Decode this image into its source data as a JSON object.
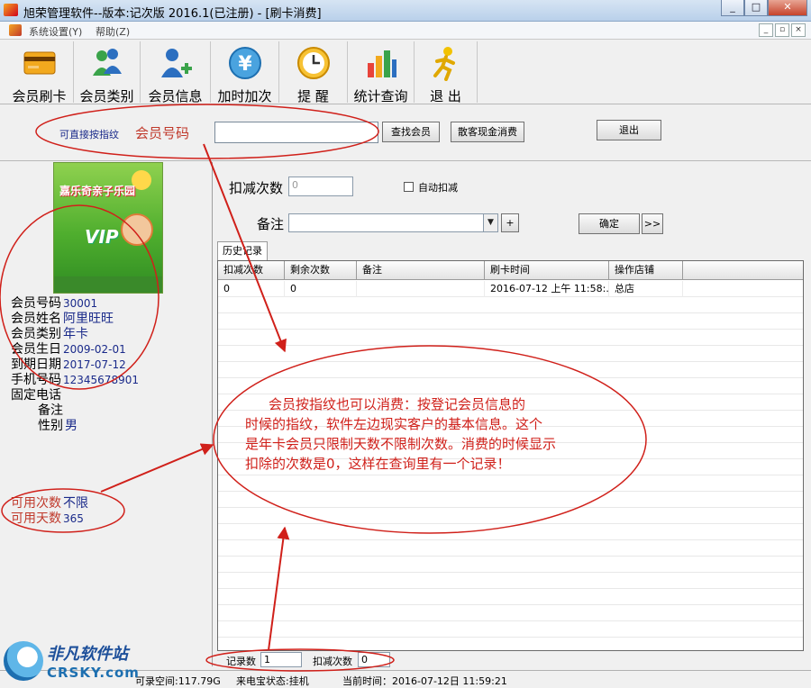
{
  "window": {
    "title": "旭荣管理软件--版本:记次版 2016.1(已注册) - [刷卡消费]",
    "buttons": [
      "_",
      "□",
      "✕"
    ]
  },
  "menu": {
    "items": [
      "系统设置(Y)",
      "帮助(Z)"
    ],
    "mdi_buttons": [
      "_",
      "▫",
      "×"
    ]
  },
  "toolbar": {
    "items": [
      "会员刷卡",
      "会员类别",
      "会员信息",
      "加时加次",
      "提 醒",
      "统计查询",
      "退 出"
    ]
  },
  "search": {
    "hint": "可直接按指纹",
    "member_no_label": "会员号码",
    "member_no_value": "",
    "find_button": "查找会员",
    "cash_button": "散客现金消费",
    "exit_button": "退出"
  },
  "card": {
    "park_name": "嘉乐奇亲子乐园",
    "vip_text": "VIP"
  },
  "member": {
    "fields": [
      {
        "label": "会员号码",
        "value": "30001"
      },
      {
        "label": "会员姓名",
        "value": "阿里旺旺"
      },
      {
        "label": "会员类别",
        "value": "年卡"
      },
      {
        "label": "会员生日",
        "value": "2009-02-01"
      },
      {
        "label": "到期日期",
        "value": "2017-07-12"
      },
      {
        "label": "手机号码",
        "value": "12345678901"
      },
      {
        "label": "固定电话",
        "value": ""
      },
      {
        "label": "备注",
        "value": ""
      },
      {
        "label": "性别",
        "value": "男"
      }
    ],
    "available_times_label": "可用次数",
    "available_times_value": "不限",
    "available_days_label": "可用天数",
    "available_days_value": "365"
  },
  "consume": {
    "deduct_label": "扣减次数",
    "deduct_value": "0",
    "auto_deduct_label": "自动扣减",
    "remark_label": "备注",
    "plus_button": "+",
    "confirm_button": "确定",
    "more_button": ">>"
  },
  "history": {
    "tab_label": "历史记录",
    "columns": [
      "扣减次数",
      "剩余次数",
      "备注",
      "刷卡时间",
      "操作店铺"
    ],
    "rows": [
      [
        "0",
        "0",
        "",
        "2016-07-12 上午 11:58:...",
        "总店"
      ]
    ]
  },
  "footer": {
    "record_count_label": "记录数",
    "record_count_value": "1",
    "deduct_total_label": "扣减次数",
    "deduct_total_value": "0"
  },
  "status": {
    "free_space": "可录空间:117.79G",
    "phone_status": "来电宝状态:挂机",
    "current_time": "当前时间：2016-07-12日 11:59:21"
  },
  "annotation": {
    "line1": "会员按指纹也可以消费：按登记会员信息的",
    "line2": "时候的指纹，软件左边现实客户的基本信息。这个",
    "line3": "是年卡会员只限制天数不限制次数。消费的时候显示",
    "line4": "扣除的次数是0，这样在查询里有一个记录！"
  },
  "watermark": {
    "cn": "非凡软件站",
    "en": "CRSKY.com"
  },
  "colors": {
    "annotation_red": "#d0201a",
    "value_blue": "#1a2a8a"
  }
}
